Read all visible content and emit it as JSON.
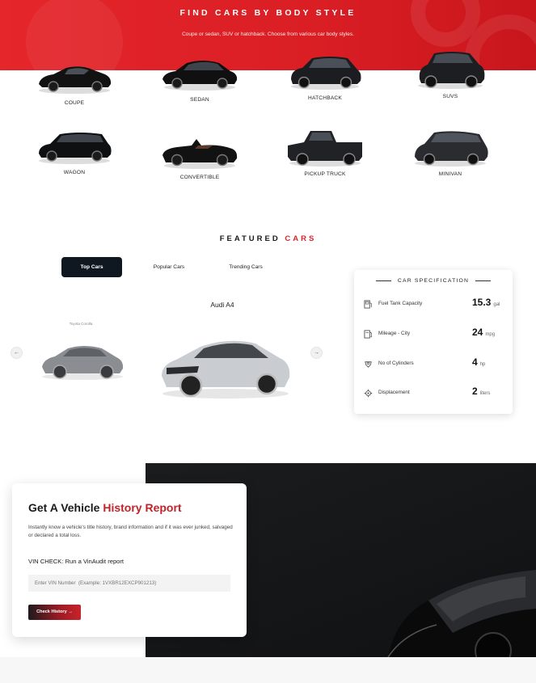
{
  "hero": {
    "title": "FIND CARS BY BODY STYLE",
    "subtitle": "Coupe or sedan, SUV or hatchback. Choose from various car body styles."
  },
  "body_styles": [
    {
      "label": "COUPE"
    },
    {
      "label": "SEDAN"
    },
    {
      "label": "HATCHBACK"
    },
    {
      "label": "SUVS"
    },
    {
      "label": "WAGON"
    },
    {
      "label": "CONVERTIBLE"
    },
    {
      "label": "PICKUP TRUCK"
    },
    {
      "label": "MINIVAN"
    }
  ],
  "featured": {
    "title_part1": "FEATURED ",
    "title_part2": "CARS",
    "tabs": [
      {
        "label": "Top Cars",
        "active": true
      },
      {
        "label": "Popular Cars",
        "active": false
      },
      {
        "label": "Trending Cars",
        "active": false
      }
    ],
    "main_car_name": "Audi A4",
    "side_car_name": "Toyota Corolla",
    "prev_arrow": "←",
    "next_arrow": "→"
  },
  "spec": {
    "title": "CAR SPECIFICATION",
    "rows": [
      {
        "label": "Fuel Tank Capacity",
        "value": "15.3",
        "unit": "gal",
        "icon": "fuel-pump-icon"
      },
      {
        "label": "Mileage - City",
        "value": "24",
        "unit": "mpg",
        "icon": "gas-station-icon"
      },
      {
        "label": "No of Cylinders",
        "value": "4",
        "unit": "hp",
        "icon": "engine-icon"
      },
      {
        "label": "Displacement",
        "value": "2",
        "unit": "liters",
        "icon": "gear-icon"
      }
    ]
  },
  "history": {
    "title_part1": "Get A Vehicle ",
    "title_part2": "History Report",
    "description": "Instantly know a vehicle's title history, brand information and if it was ever junked, salvaged or declared a total loss.",
    "vin_label": "VIN CHECK: Run a VinAudit report",
    "vin_placeholder": "Enter VIN Number  (Example: 1VXBR12EXCP901213)",
    "button_label": "Check History",
    "button_arrow": "→"
  },
  "colors": {
    "accent": "#d8262b",
    "dark_tab": "#0f1821"
  }
}
